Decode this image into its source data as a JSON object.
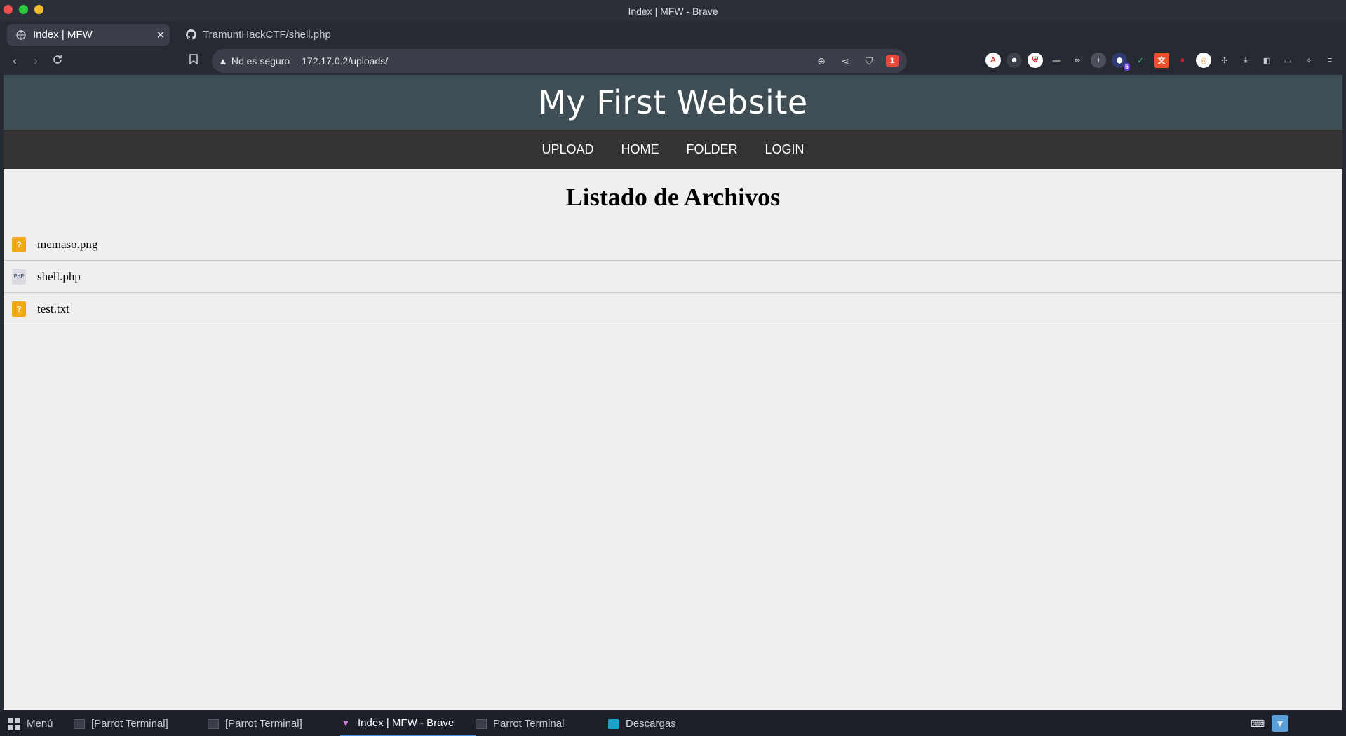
{
  "window": {
    "title": "Index | MFW - Brave"
  },
  "tabs": [
    {
      "label": "Index | MFW",
      "icon": "globe-icon",
      "active": true
    },
    {
      "label": "TramuntHackCTF/shell.php",
      "icon": "github-icon",
      "active": false
    }
  ],
  "toolbar": {
    "security_label": "No es seguro",
    "url": "172.17.0.2/uploads/",
    "rewards_badge": "1",
    "extension_badge": "5"
  },
  "site": {
    "title": "My First Website",
    "nav": [
      "UPLOAD",
      "HOME",
      "FOLDER",
      "LOGIN"
    ]
  },
  "files": {
    "heading": "Listado de Archivos",
    "items": [
      {
        "name": "memaso.png",
        "icon": "unknown-file-icon"
      },
      {
        "name": "shell.php",
        "icon": "php-file-icon"
      },
      {
        "name": "test.txt",
        "icon": "unknown-file-icon"
      }
    ]
  },
  "taskbar": {
    "menu_label": "Menú",
    "items": [
      {
        "label": "[Parrot Terminal]",
        "icon": "terminal-icon",
        "active": false
      },
      {
        "label": "[Parrot Terminal]",
        "icon": "terminal-icon",
        "active": false
      },
      {
        "label": "Index | MFW - Brave",
        "icon": "brave-icon",
        "active": true
      },
      {
        "label": "Parrot Terminal",
        "icon": "terminal-icon",
        "active": false
      },
      {
        "label": "Descargas",
        "icon": "folder-icon",
        "active": false
      }
    ]
  },
  "colors": {
    "site_header": "#3f4d55",
    "site_nav": "#333333",
    "page_bg": "#efefef",
    "unknown_file_icon": "#f2a81c"
  }
}
